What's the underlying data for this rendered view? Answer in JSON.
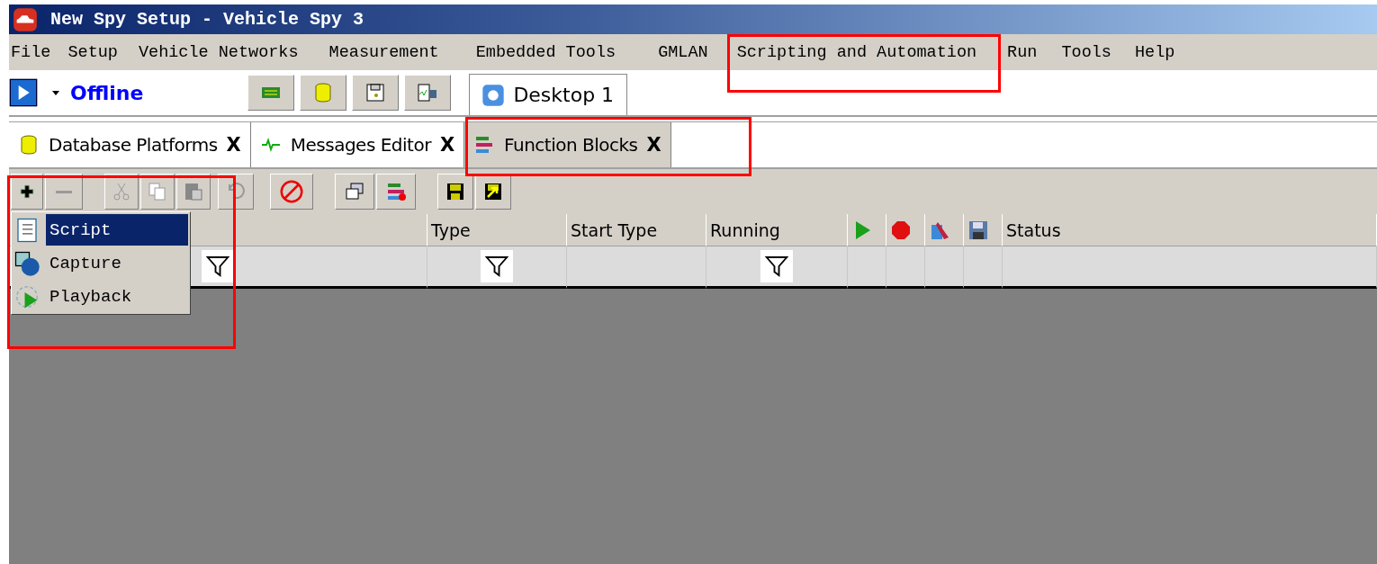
{
  "window": {
    "title": "New Spy Setup - Vehicle Spy 3"
  },
  "menu": [
    {
      "label": "File"
    },
    {
      "label": "Setup"
    },
    {
      "label": "Vehicle Networks"
    },
    {
      "label": "Measurement"
    },
    {
      "label": "Embedded Tools"
    },
    {
      "label": "GMLAN"
    },
    {
      "label": "Scripting and Automation"
    },
    {
      "label": "Run"
    },
    {
      "label": "Tools"
    },
    {
      "label": "Help"
    }
  ],
  "annotations": [
    {
      "kind": "menu"
    },
    {
      "kind": "tab"
    },
    {
      "kind": "add-menu"
    }
  ],
  "status": {
    "label": "Offline"
  },
  "desktop_tab": {
    "label": "Desktop 1"
  },
  "tabs": [
    {
      "label": "Database Platforms",
      "close": "X",
      "selected": false
    },
    {
      "label": "Messages Editor",
      "close": "X",
      "selected": false
    },
    {
      "label": "Function Blocks",
      "close": "X",
      "selected": true
    }
  ],
  "table": {
    "columns": [
      {
        "kind": "blank",
        "filter": true
      },
      {
        "label": "Type",
        "filter": true
      },
      {
        "label": "Start Type",
        "filter": false
      },
      {
        "label": "Running",
        "filter": true
      },
      {
        "kind": "play",
        "filter": false
      },
      {
        "kind": "stop",
        "filter": false
      },
      {
        "kind": "tools",
        "filter": false
      },
      {
        "kind": "save",
        "filter": false
      },
      {
        "label": "Status",
        "filter": false
      }
    ]
  },
  "add_menu": {
    "items": [
      {
        "label": "Script",
        "kind": "script",
        "selected": true
      },
      {
        "label": "Capture",
        "kind": "capture",
        "selected": false
      },
      {
        "label": "Playback",
        "kind": "playback",
        "selected": false
      }
    ]
  }
}
